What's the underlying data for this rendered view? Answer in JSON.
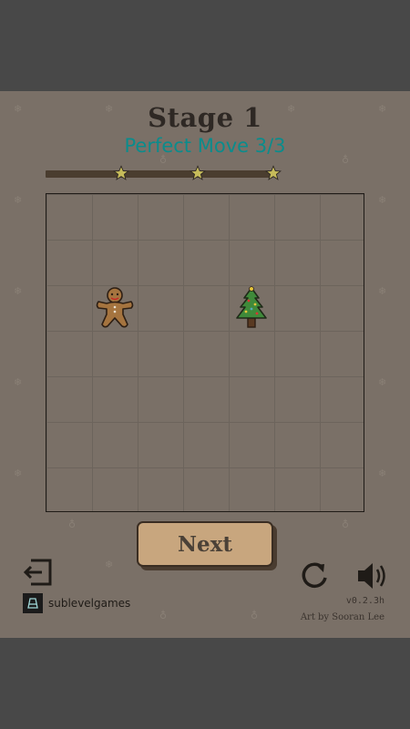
{
  "stage": {
    "title": "Stage 1",
    "perfect_move": "Perfect Move 3/3"
  },
  "progress": {
    "stars_earned": 3,
    "stars_total": 3
  },
  "board": {
    "rows": 7,
    "cols": 7,
    "pieces": [
      {
        "type": "gingerbread-man",
        "row": 2,
        "col": 1
      },
      {
        "type": "christmas-tree",
        "row": 2,
        "col": 4
      }
    ]
  },
  "buttons": {
    "next_label": "Next"
  },
  "icons": {
    "exit": "exit-icon",
    "restart": "restart-icon",
    "sound": "speaker-icon",
    "star": "star-icon"
  },
  "branding": {
    "name": "sublevelgames"
  },
  "footer": {
    "version": "v0.2.3h",
    "credit": "Art by Sooran Lee"
  },
  "colors": {
    "background": "#7a7067",
    "title": "#2e2824",
    "subtitle": "#0b8c8c",
    "button": "#c8a67e",
    "star": "#c6bb5a"
  }
}
